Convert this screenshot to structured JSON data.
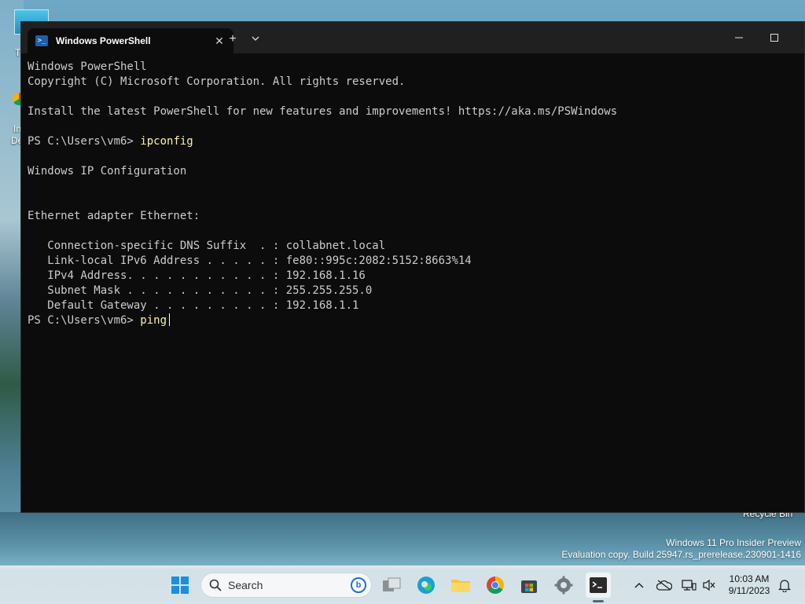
{
  "desktop": {
    "icon_labels": [
      "T",
      "In",
      "De"
    ],
    "recycle_bin": "Recycle Bin",
    "watermark": {
      "line1": "Windows 11 Pro Insider Preview",
      "line2": "Evaluation copy. Build 25947.rs_prerelease.230901-1416"
    }
  },
  "window": {
    "tab_title": "Windows PowerShell",
    "new_tab": "+",
    "dropdown": "⌄",
    "minimize": "—",
    "maximize": "☐"
  },
  "terminal": {
    "lines": [
      {
        "text": "Windows PowerShell"
      },
      {
        "text": "Copyright (C) Microsoft Corporation. All rights reserved."
      },
      {
        "text": ""
      },
      {
        "text": "Install the latest PowerShell for new features and improvements! https://aka.ms/PSWindows"
      },
      {
        "text": ""
      },
      {
        "prompt": "PS C:\\Users\\vm6> ",
        "command": "ipconfig"
      },
      {
        "text": ""
      },
      {
        "text": "Windows IP Configuration"
      },
      {
        "text": ""
      },
      {
        "text": ""
      },
      {
        "text": "Ethernet adapter Ethernet:"
      },
      {
        "text": ""
      },
      {
        "text": "   Connection-specific DNS Suffix  . : collabnet.local"
      },
      {
        "text": "   Link-local IPv6 Address . . . . . : fe80::995c:2082:5152:8663%14"
      },
      {
        "text": "   IPv4 Address. . . . . . . . . . . : 192.168.1.16"
      },
      {
        "text": "   Subnet Mask . . . . . . . . . . . : 255.255.255.0"
      },
      {
        "text": "   Default Gateway . . . . . . . . . : 192.168.1.1"
      },
      {
        "prompt": "PS C:\\Users\\vm6> ",
        "command": "ping",
        "cursor": true
      }
    ]
  },
  "taskbar": {
    "search_label": "Search",
    "time": "10:03 AM",
    "date": "9/11/2023",
    "apps": [
      "start-icon",
      "task-view-icon",
      "edge-icon",
      "file-explorer-icon",
      "chrome-icon",
      "store-icon",
      "settings-icon",
      "terminal-icon"
    ]
  }
}
